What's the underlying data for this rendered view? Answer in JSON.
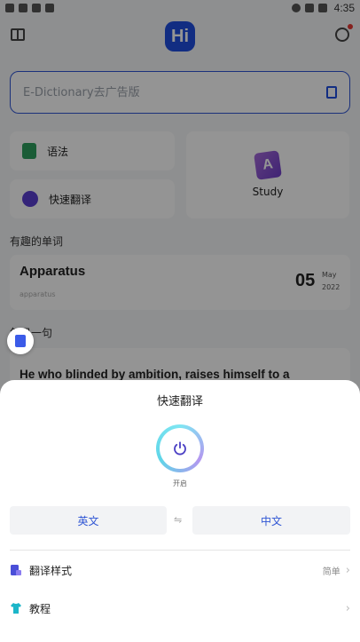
{
  "status_bar": {
    "time": "4:35",
    "left_icons": [
      "notification-icon",
      "notification-icon",
      "download-icon",
      "notification-icon"
    ],
    "right_icons": [
      "wifi-icon",
      "signal-icon",
      "battery-icon"
    ]
  },
  "header": {
    "logo_text": "Hi",
    "brand_color": "#1f4fe0"
  },
  "search": {
    "placeholder": "E-Dictionary去广告版"
  },
  "tiles": {
    "grammar": "语法",
    "quick_translate": "快速翻译",
    "study": "Study",
    "study_icon_letter": "A"
  },
  "interesting_words": {
    "section_title": "有趣的单词",
    "word": "Apparatus",
    "subtitle": "apparatus",
    "day": "05",
    "month": "May",
    "year": "2022"
  },
  "daily_sentence": {
    "section_title": "每日一句",
    "sentence": "He who blinded by ambition, raises himself to a"
  },
  "sheet": {
    "title": "快速翻译",
    "power_label": "开启",
    "source_lang": "英文",
    "target_lang": "中文",
    "swap_symbol": "⇋",
    "style_label": "翻译样式",
    "style_value": "简单",
    "tutorial_label": "教程",
    "accent_color": "#2f55d4"
  }
}
